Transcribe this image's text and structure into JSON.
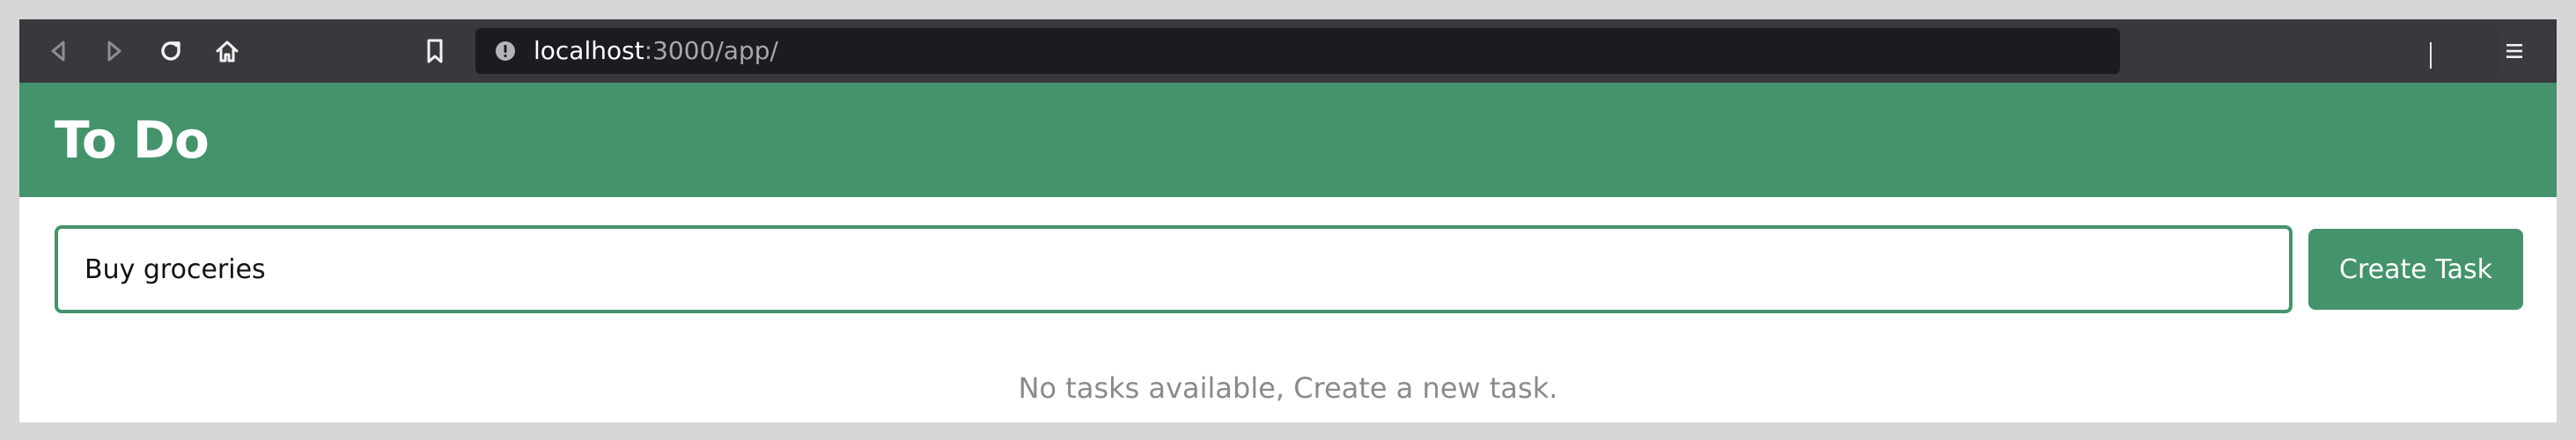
{
  "browser": {
    "url_host": "localhost",
    "url_rest": ":3000/app/",
    "icons": {
      "back": "back-arrow-icon",
      "forward": "forward-arrow-icon",
      "reload": "reload-icon",
      "home": "home-icon",
      "bookmark": "bookmark-icon",
      "site_info": "info-icon",
      "menu": "hamburger-menu-icon"
    }
  },
  "app": {
    "title": "To Do",
    "accent_color": "#44936c"
  },
  "task_form": {
    "input_value": "Buy groceries",
    "create_label": "Create Task"
  },
  "task_list": {
    "empty_message": "No tasks available, Create a new task."
  }
}
